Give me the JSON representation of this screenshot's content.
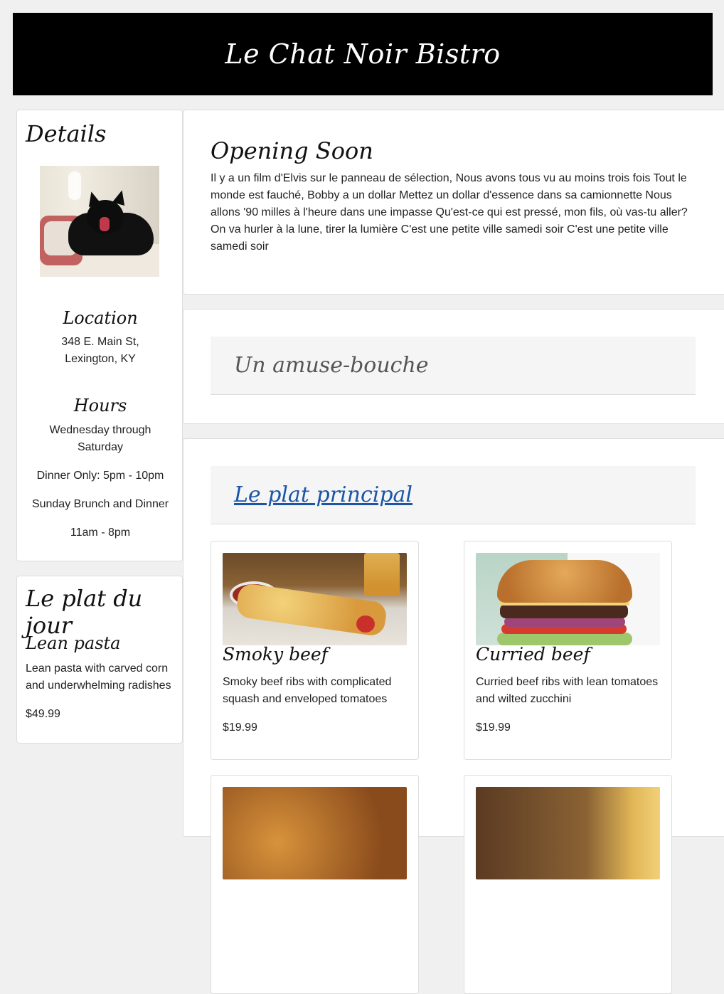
{
  "site": {
    "title": "Le Chat Noir Bistro"
  },
  "details": {
    "heading": "Details",
    "location_heading": "Location",
    "address_line1": "348 E. Main St,",
    "address_line2": "Lexington, KY",
    "hours_heading": "Hours",
    "hours_line1": "Wednesday through",
    "hours_line2": "Saturday",
    "dinner": "Dinner Only: 5pm - 10pm",
    "sunday": "Sunday Brunch and Dinner",
    "sunday_hours": "11am - 8pm"
  },
  "special": {
    "heading": "Le plat du jour",
    "name": "Lean pasta",
    "description": "Lean pasta with carved corn and underwhelming radishes",
    "price": "$49.99"
  },
  "opening": {
    "heading": "Opening Soon",
    "text": "Il y a un film d'Elvis sur le panneau de sélection, Nous avons tous vu au moins trois fois Tout le monde est fauché, Bobby a un dollar Mettez un dollar d'essence dans sa camionnette Nous allons '90 milles à l'heure dans une impasse Qu'est-ce qui est pressé, mon fils, où vas-tu aller? On va hurler à la lune, tirer la lumière C'est une petite ville samedi soir C'est une petite ville samedi soir"
  },
  "amuse": {
    "heading": "Un amuse-bouche"
  },
  "main_course": {
    "heading": "Le plat principal",
    "dishes": [
      {
        "name": "Smoky beef",
        "description": "Smoky beef ribs with complicated squash and enveloped tomatoes",
        "price": "$19.99"
      },
      {
        "name": "Curried beef",
        "description": "Curried beef ribs with lean tomatoes and wilted zucchini",
        "price": "$19.99"
      }
    ]
  },
  "colors": {
    "banner": "#000000",
    "link": "#1a55a8",
    "background": "#f0f0f0"
  }
}
